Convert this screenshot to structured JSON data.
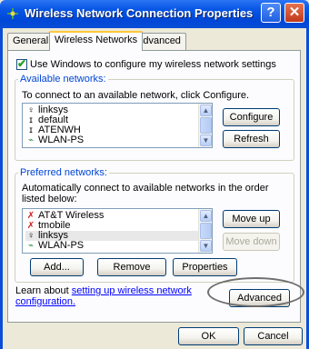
{
  "window": {
    "title": "Wireless Network Connection Properties",
    "help_label": "?",
    "close_label": "✕"
  },
  "tabs": [
    {
      "label": "General",
      "active": false
    },
    {
      "label": "Wireless Networks",
      "active": true
    },
    {
      "label": "Advanced",
      "active": false
    }
  ],
  "use_windows": {
    "label": "Use Windows to configure my wireless network settings",
    "checked": true
  },
  "available": {
    "title": "Available networks:",
    "instruction": "To connect to an available network, click Configure.",
    "networks": [
      {
        "name": "linksys",
        "icon": "wireless-antenna-icon"
      },
      {
        "name": "default",
        "icon": "adhoc-icon"
      },
      {
        "name": "ATENWH",
        "icon": "adhoc-icon"
      },
      {
        "name": "WLAN-PS",
        "icon": "wireless-antenna-icon"
      }
    ],
    "configure_label": "Configure",
    "refresh_label": "Refresh"
  },
  "preferred": {
    "title": "Preferred networks:",
    "instruction": "Automatically connect to available networks in the order listed below:",
    "networks": [
      {
        "name": "AT&T Wireless",
        "icon": "unavailable-network-icon"
      },
      {
        "name": "tmobile",
        "icon": "unavailable-network-icon"
      },
      {
        "name": "linksys",
        "icon": "wireless-antenna-icon"
      },
      {
        "name": "WLAN-PS",
        "icon": "wireless-antenna-icon"
      }
    ],
    "move_up_label": "Move up",
    "move_down_label": "Move down",
    "add_label": "Add...",
    "remove_label": "Remove",
    "properties_label": "Properties"
  },
  "learn": {
    "prefix": "Learn about ",
    "link": "setting up wireless network",
    "link2": "configuration."
  },
  "advanced_label": "Advanced",
  "ok_label": "OK",
  "cancel_label": "Cancel",
  "colors": {
    "titlebar": "#0A58E6",
    "dialog_bg": "#ECE9D8",
    "group_title": "#0046D5",
    "active_tab_accent": "#FFC83C"
  }
}
